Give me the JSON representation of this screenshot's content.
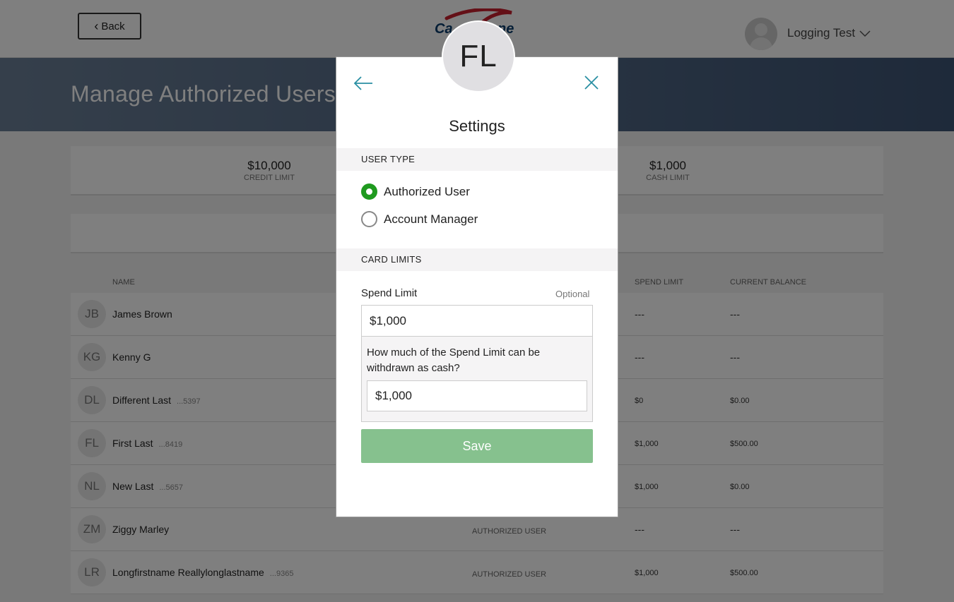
{
  "header": {
    "back_label": "Back",
    "user_name": "Logging Test"
  },
  "page": {
    "title": "Manage Authorized Users"
  },
  "limits": {
    "credit": {
      "amount": "$10,000",
      "label": "CREDIT LIMIT"
    },
    "cash": {
      "amount": "$1,000",
      "label": "CASH LIMIT"
    }
  },
  "table": {
    "headers": {
      "name": "NAME",
      "spend": "SPEND LIMIT",
      "balance": "CURRENT BALANCE"
    },
    "rows": [
      {
        "initials": "JB",
        "name": "James Brown",
        "acct": "",
        "type": "",
        "spend": "---",
        "balance": "---"
      },
      {
        "initials": "KG",
        "name": "Kenny G",
        "acct": "",
        "type": "",
        "spend": "---",
        "balance": "---"
      },
      {
        "initials": "DL",
        "name": "Different Last",
        "acct": "...5397",
        "type": "",
        "spend": "$0",
        "balance": "$0.00"
      },
      {
        "initials": "FL",
        "name": "First Last",
        "acct": "...8419",
        "type": "",
        "spend": "$1,000",
        "balance": "$500.00"
      },
      {
        "initials": "NL",
        "name": "New Last",
        "acct": "...5657",
        "type": "",
        "spend": "$1,000",
        "balance": "$0.00"
      },
      {
        "initials": "ZM",
        "name": "Ziggy Marley",
        "acct": "",
        "type": "AUTHORIZED USER",
        "spend": "---",
        "balance": "---"
      },
      {
        "initials": "LR",
        "name": "Longfirstname Reallylonglastname",
        "acct": "...9365",
        "type": "AUTHORIZED USER",
        "spend": "$1,000",
        "balance": "$500.00"
      }
    ]
  },
  "modal": {
    "initials": "FL",
    "title": "Settings",
    "user_type_label": "USER TYPE",
    "options": [
      {
        "label": "Authorized User",
        "selected": true
      },
      {
        "label": "Account Manager",
        "selected": false
      }
    ],
    "card_limits_label": "CARD LIMITS",
    "spend_limit_label": "Spend Limit",
    "optional_label": "Optional",
    "spend_limit_value": "$1,000",
    "cash_question": "How much of the Spend Limit can be withdrawn as cash?",
    "cash_limit_value": "$1,000",
    "save_label": "Save"
  },
  "colors": {
    "accent_green": "#1f9a1f",
    "save_button": "#86c18e",
    "icon_teal": "#2a8fa3",
    "hero_blue": "#4f6684"
  }
}
